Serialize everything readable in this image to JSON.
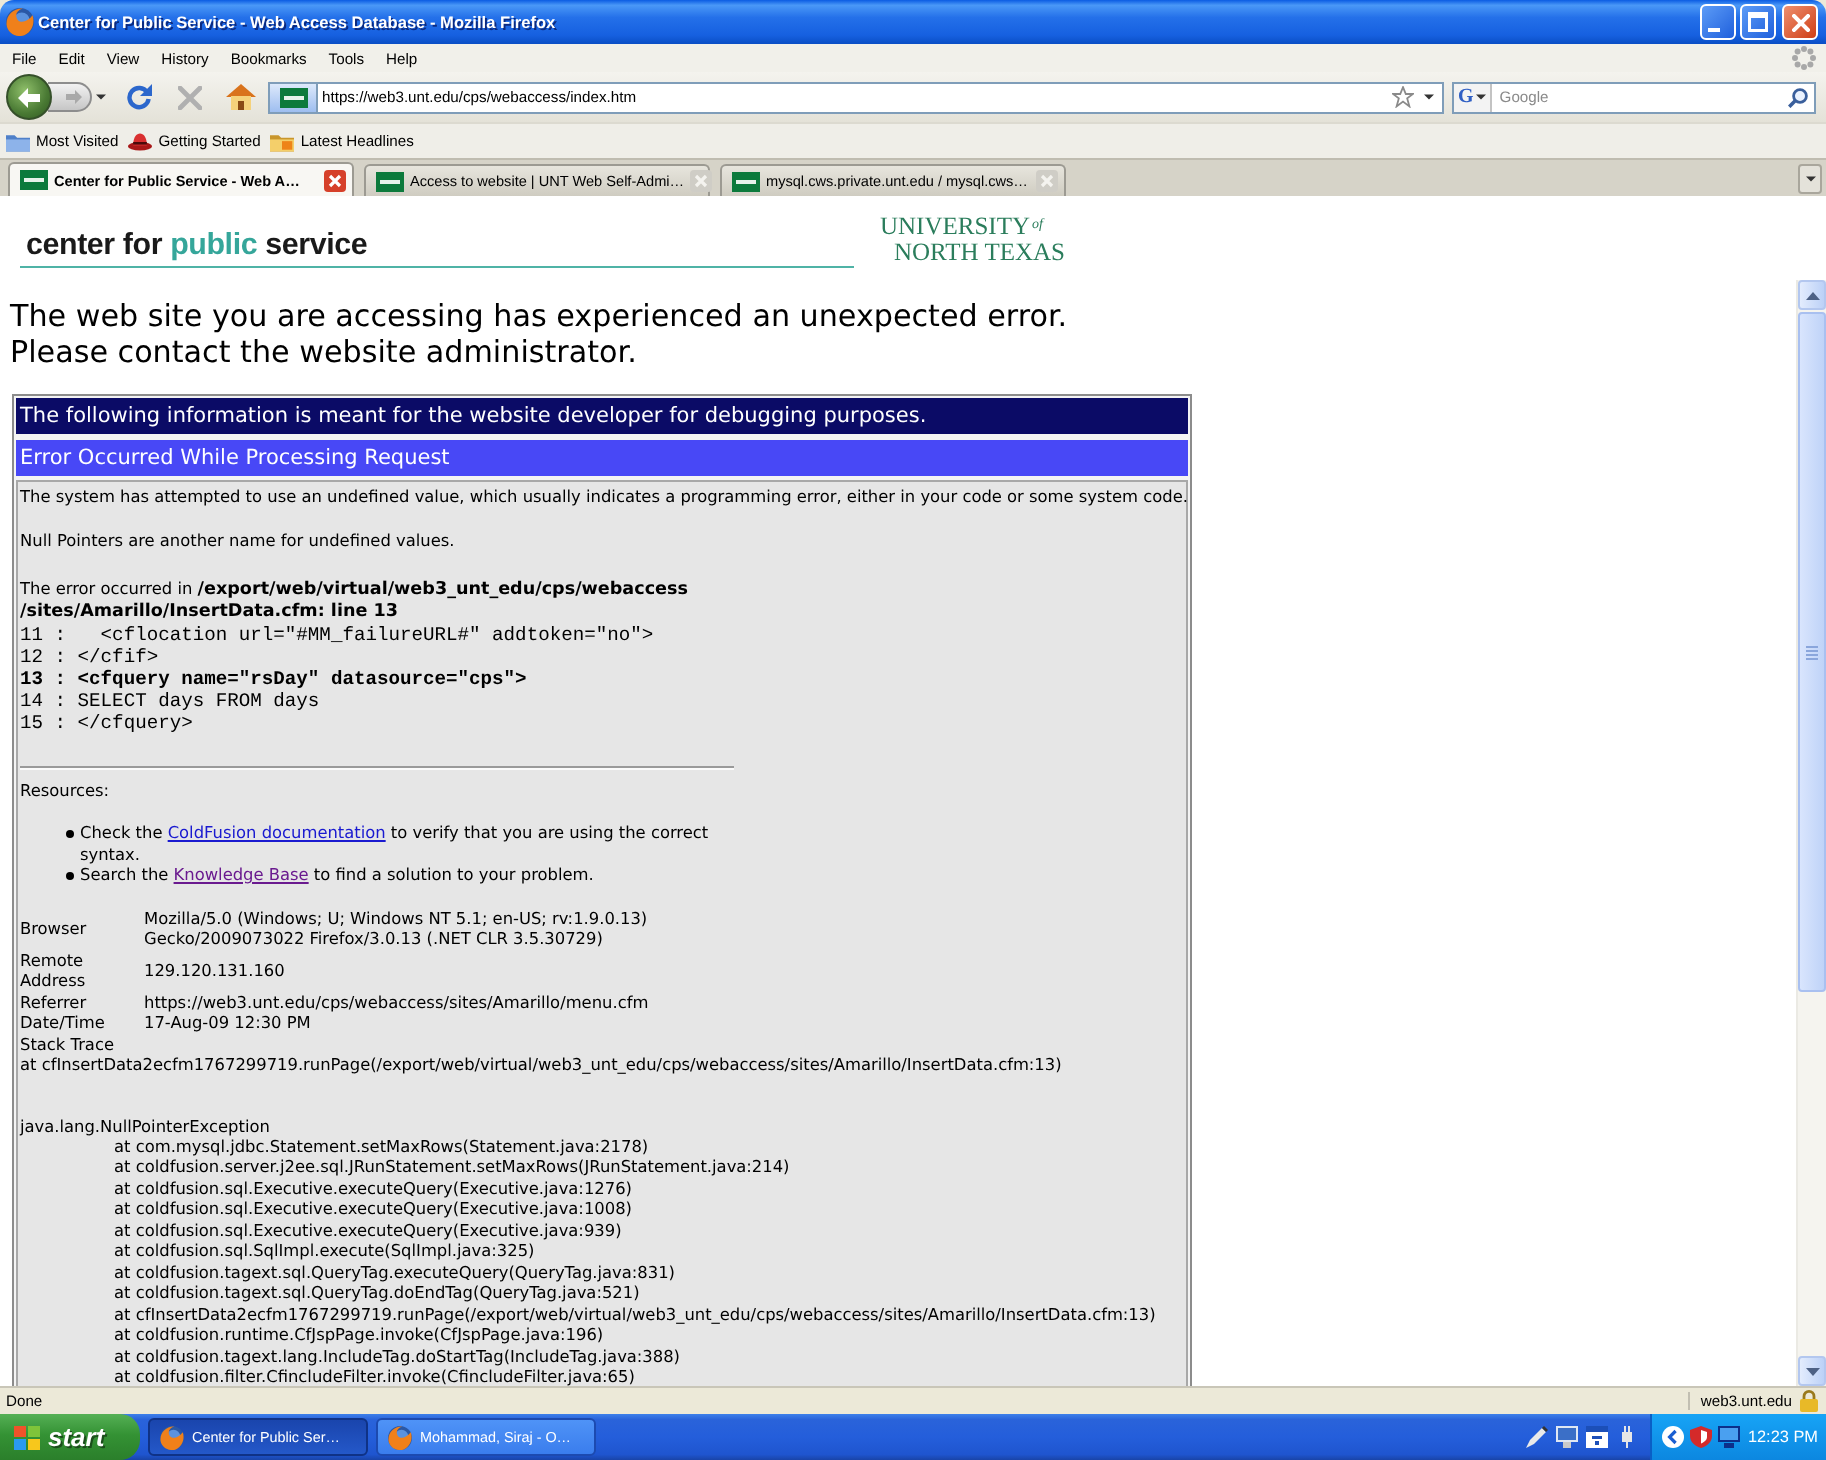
{
  "window": {
    "title": "Center for Public Service - Web Access Database - Mozilla Firefox"
  },
  "menu": [
    {
      "label": "File"
    },
    {
      "label": "Edit"
    },
    {
      "label": "View"
    },
    {
      "label": "History"
    },
    {
      "label": "Bookmarks"
    },
    {
      "label": "Tools"
    },
    {
      "label": "Help"
    }
  ],
  "navigation": {
    "forward": {
      "disabled": true
    },
    "stop": {
      "disabled": true
    },
    "url": "https://web3.unt.edu/cps/webaccess/index.htm",
    "search": {
      "engine": "G",
      "placeholder": "Google"
    }
  },
  "bookmarks": [
    {
      "label": "Most Visited",
      "kind": "folder"
    },
    {
      "label": "Getting Started",
      "kind": "page"
    },
    {
      "label": "Latest Headlines",
      "kind": "feed"
    }
  ],
  "tabs": [
    {
      "label": "Center for Public Service - Web A…",
      "selected": true
    },
    {
      "label": "Access to website | UNT Web Self-Admi…",
      "selected": false
    },
    {
      "label": "mysql.cws.private.unt.edu / mysql.cws…",
      "selected": false
    }
  ],
  "header": {
    "brand": [
      {
        "text": "center for ",
        "color": "#1a1a1a"
      },
      {
        "text": "public",
        "color": "#35a69a"
      },
      {
        "text": " service",
        "color": "#1a1a1a"
      }
    ],
    "logo": {
      "line_1": "UNIVERSITY",
      "of": "of",
      "line_2": "NORTH TEXAS"
    }
  },
  "message": [
    "The web site you are accessing has experienced an unexpected error.",
    "Please contact the website administrator."
  ],
  "error": {
    "banner": "The following information is meant for the website developer for debugging purposes.",
    "heading": "Error Occurred While Processing Request",
    "description": "The system has attempted to use an undefined value, which usually indicates a programming error, either in your code or some system code.",
    "note": "Null Pointers are another name for undefined values.",
    "location": [
      "The error occurred in **/export/web/virtual/web3_unt_edu/cps/webaccess**",
      "**/sites/Amarillo/InsertData.cfm: line 13**"
    ],
    "code": [
      {
        "text": "11 :   <cflocation url=\"#MM_failureURL#\" addtoken=\"no\">",
        "highlighted": false
      },
      {
        "text": "12 : </cfif>",
        "highlighted": false
      },
      {
        "text": "13 : <cfquery name=\"rsDay\" datasource=\"cps\">",
        "highlighted": true
      },
      {
        "text": "14 : SELECT days FROM days",
        "highlighted": false
      },
      {
        "text": "15 : </cfquery>",
        "highlighted": false
      }
    ],
    "resources": {
      "label": "Resources:",
      "items": [
        {
          "before": "Check the ",
          "link": "ColdFusion documentation",
          "after": " to verify that you are using the correct syntax.",
          "visited": false
        },
        {
          "before": "Search the ",
          "link": "Knowledge Base",
          "after": " to find a solution to your problem.",
          "visited": true
        }
      ]
    },
    "details": [
      {
        "label": "Browser",
        "value": "Mozilla/5.0 (Windows; U; Windows NT 5.1; en-US; rv:1.9.0.13) Gecko/2009073022 Firefox/3.0.13 (.NET CLR 3.5.30729)"
      },
      {
        "label": "Remote Address",
        "value": "129.120.131.160"
      },
      {
        "label": "Referrer",
        "value": "https://web3.unt.edu/cps/webaccess/sites/Amarillo/menu.cfm"
      },
      {
        "label": "Date/Time",
        "value": "17-Aug-09 12:30 PM"
      },
      {
        "label": "Stack Trace"
      }
    ],
    "stack_trace": {
      "summary": "at cfInsertData2ecfm1767299719.runPage(/export/web/virtual/web3_unt_edu/cps/webaccess/sites/Amarillo/InsertData.cfm:13)",
      "exception": "java.lang.NullPointerException",
      "frames": [
        "at com.mysql.jdbc.Statement.setMaxRows(Statement.java:2178)",
        "at coldfusion.server.j2ee.sql.JRunStatement.setMaxRows(JRunStatement.java:214)",
        "at coldfusion.sql.Executive.executeQuery(Executive.java:1276)",
        "at coldfusion.sql.Executive.executeQuery(Executive.java:1008)",
        "at coldfusion.sql.Executive.executeQuery(Executive.java:939)",
        "at coldfusion.sql.SqlImpl.execute(SqlImpl.java:325)",
        "at coldfusion.tagext.sql.QueryTag.executeQuery(QueryTag.java:831)",
        "at coldfusion.tagext.sql.QueryTag.doEndTag(QueryTag.java:521)",
        "at cfInsertData2ecfm1767299719.runPage(/export/web/virtual/web3_unt_edu/cps/webaccess/sites/Amarillo/InsertData.cfm:13)",
        "at coldfusion.runtime.CfJspPage.invoke(CfJspPage.java:196)",
        "at coldfusion.tagext.lang.IncludeTag.doStartTag(IncludeTag.java:388)",
        "at coldfusion.filter.CfincludeFilter.invoke(CfincludeFilter.java:65)"
      ]
    }
  },
  "status_bar": {
    "text": "Done",
    "host": "web3.unt.edu"
  },
  "taskbar": {
    "start": "start",
    "tasks": [
      {
        "label": "Center for Public Ser…",
        "selected": true
      },
      {
        "label": "Mohammad, Siraj - O…",
        "selected": false
      }
    ],
    "clock": "12:23 PM"
  }
}
